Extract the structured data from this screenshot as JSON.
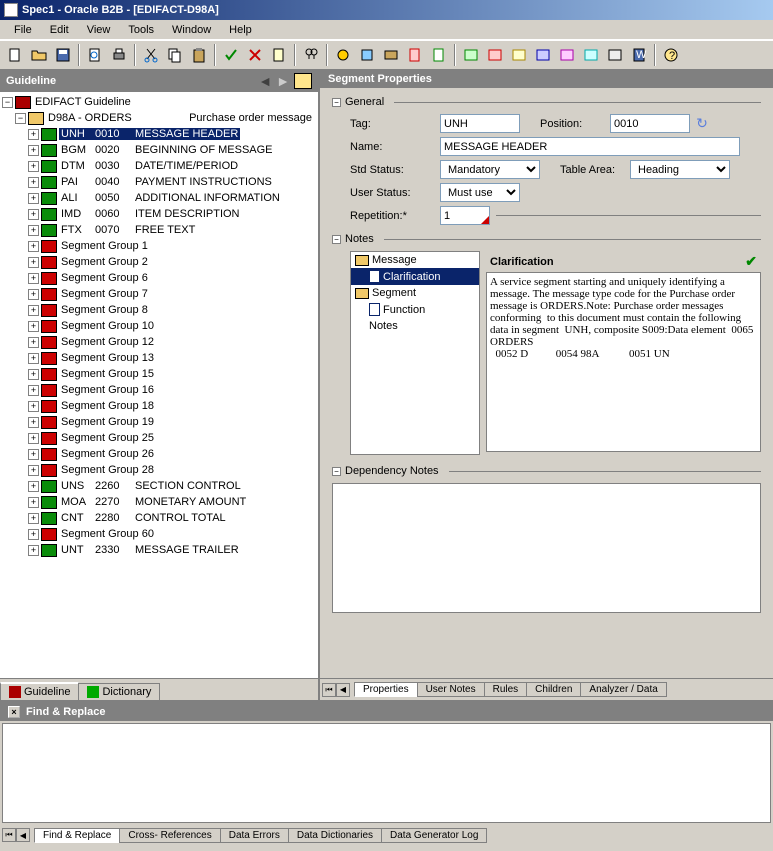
{
  "window_title": "Spec1 - Oracle B2B - [EDIFACT-D98A]",
  "menus": [
    "File",
    "Edit",
    "View",
    "Tools",
    "Window",
    "Help"
  ],
  "guideline": {
    "title": "Guideline",
    "root": "EDIFACT Guideline",
    "doc": "D98A - ORDERS",
    "doc_desc": "Purchase order message",
    "items": [
      {
        "tag": "UNH",
        "pos": "0010",
        "name": "MESSAGE HEADER",
        "ic": "green",
        "sel": true
      },
      {
        "tag": "BGM",
        "pos": "0020",
        "name": "BEGINNING OF MESSAGE",
        "ic": "green"
      },
      {
        "tag": "DTM",
        "pos": "0030",
        "name": "DATE/TIME/PERIOD",
        "ic": "green"
      },
      {
        "tag": "PAI",
        "pos": "0040",
        "name": "PAYMENT INSTRUCTIONS",
        "ic": "green"
      },
      {
        "tag": "ALI",
        "pos": "0050",
        "name": "ADDITIONAL INFORMATION",
        "ic": "green"
      },
      {
        "tag": "IMD",
        "pos": "0060",
        "name": "ITEM DESCRIPTION",
        "ic": "green"
      },
      {
        "tag": "FTX",
        "pos": "0070",
        "name": "FREE TEXT",
        "ic": "green"
      },
      {
        "tag": "",
        "pos": "",
        "name": "Segment Group 1",
        "ic": "red"
      },
      {
        "tag": "",
        "pos": "",
        "name": "Segment Group 2",
        "ic": "red"
      },
      {
        "tag": "",
        "pos": "",
        "name": "Segment Group 6",
        "ic": "red"
      },
      {
        "tag": "",
        "pos": "",
        "name": "Segment Group 7",
        "ic": "red"
      },
      {
        "tag": "",
        "pos": "",
        "name": "Segment Group 8",
        "ic": "red"
      },
      {
        "tag": "",
        "pos": "",
        "name": "Segment Group 10",
        "ic": "red"
      },
      {
        "tag": "",
        "pos": "",
        "name": "Segment Group 12",
        "ic": "red"
      },
      {
        "tag": "",
        "pos": "",
        "name": "Segment Group 13",
        "ic": "red"
      },
      {
        "tag": "",
        "pos": "",
        "name": "Segment Group 15",
        "ic": "red"
      },
      {
        "tag": "",
        "pos": "",
        "name": "Segment Group 16",
        "ic": "red"
      },
      {
        "tag": "",
        "pos": "",
        "name": "Segment Group 18",
        "ic": "red"
      },
      {
        "tag": "",
        "pos": "",
        "name": "Segment Group 19",
        "ic": "red"
      },
      {
        "tag": "",
        "pos": "",
        "name": "Segment Group 25",
        "ic": "red"
      },
      {
        "tag": "",
        "pos": "",
        "name": "Segment Group 26",
        "ic": "red"
      },
      {
        "tag": "",
        "pos": "",
        "name": "Segment Group 28",
        "ic": "red"
      },
      {
        "tag": "UNS",
        "pos": "2260",
        "name": "SECTION CONTROL",
        "ic": "green"
      },
      {
        "tag": "MOA",
        "pos": "2270",
        "name": "MONETARY AMOUNT",
        "ic": "green"
      },
      {
        "tag": "CNT",
        "pos": "2280",
        "name": "CONTROL TOTAL",
        "ic": "green"
      },
      {
        "tag": "",
        "pos": "",
        "name": "Segment Group 60",
        "ic": "red"
      },
      {
        "tag": "UNT",
        "pos": "2330",
        "name": "MESSAGE TRAILER",
        "ic": "green"
      }
    ],
    "tabs": [
      "Guideline",
      "Dictionary"
    ]
  },
  "segment": {
    "title": "Segment Properties",
    "general": "General",
    "labels": {
      "tag": "Tag:",
      "position": "Position:",
      "name": "Name:",
      "std": "Std Status:",
      "table": "Table Area:",
      "user": "User Status:",
      "rep": "Repetition:*"
    },
    "tag_val": "UNH",
    "pos_val": "0010",
    "name_val": "MESSAGE HEADER",
    "std_val": "Mandatory",
    "table_val": "Heading",
    "user_val": "Must use",
    "rep_val": "1",
    "notes_label": "Notes",
    "notes_tree": [
      "Message",
      "Clarification",
      "Segment",
      "Function",
      "Notes"
    ],
    "clarification_title": "Clarification",
    "clarification_text": "A service segment starting and uniquely identifying a  message. The message type code for the Purchase order  message is ORDERS.Note: Purchase order messages conforming  to this document must contain the following data in segment  UNH, composite S009:Data element  0065 ORDERS\n  0052 D          0054 98A           0051 UN",
    "dep_label": "Dependency Notes",
    "tabs": [
      "Properties",
      "User Notes",
      "Rules",
      "Children",
      "Analyzer / Data"
    ]
  },
  "find": {
    "title": "Find & Replace",
    "tabs": [
      "Find & Replace",
      "Cross- References",
      "Data Errors",
      "Data Dictionaries",
      "Data Generator Log"
    ]
  }
}
